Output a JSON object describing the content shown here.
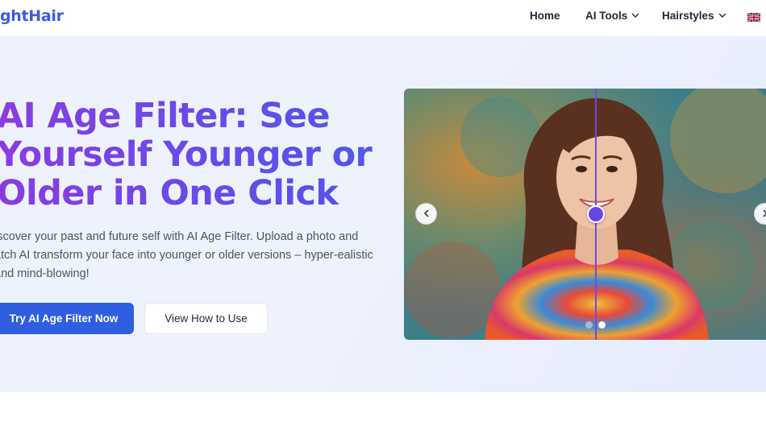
{
  "brand": {
    "logo_text": "ghtHair",
    "logo_color": "#3b5bdb"
  },
  "nav": {
    "home": "Home",
    "ai_tools": "AI Tools",
    "hairstyles": "Hairstyles",
    "language_icon": "uk-flag-icon"
  },
  "hero": {
    "title": "AI Age Filter: See Yourself Younger or Older in One Click",
    "description": "iscover your past and future self with AI Age Filter. Upload a photo and atch AI transform your face into younger or older versions – hyper-ealistic and mind-blowing!",
    "primary_button": "Try AI Age Filter Now",
    "secondary_button": "View How to Use",
    "accent_color": "#2f5ee0"
  },
  "comparison": {
    "slider_position": 0.52,
    "active_slide": 2,
    "slide_count": 2,
    "handle_color": "#6a45e6",
    "prev_icon": "chevron-left-icon",
    "next_icon": "chevron-right-icon"
  }
}
